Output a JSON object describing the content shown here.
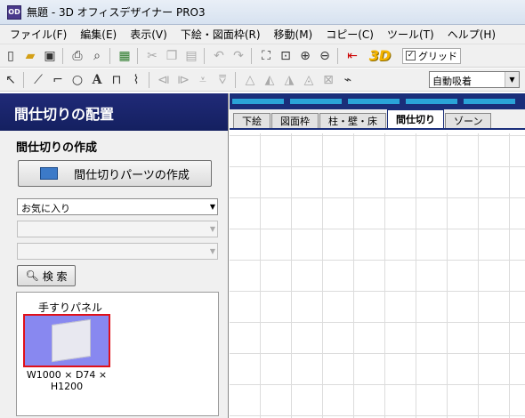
{
  "window": {
    "title": "無題 - 3D オフィスデザイナー PRO3",
    "app_icon": "OD"
  },
  "menu": [
    "ファイル(F)",
    "編集(E)",
    "表示(V)",
    "下絵・図面枠(R)",
    "移動(M)",
    "コピー(C)",
    "ツール(T)",
    "ヘルプ(H)"
  ],
  "toolbar1": {
    "view3d_label": "3D",
    "grid_label": "グリッド",
    "grid_checked": "✓"
  },
  "toolbar2": {
    "snap_value": "自動吸着"
  },
  "left_panel": {
    "header": "間仕切りの配置",
    "subtitle": "間仕切りの作成",
    "create_button": "間仕切りパーツの作成",
    "category_select": "お気に入り",
    "search_button": "検 索",
    "library_item": {
      "name": "手すりパネル",
      "dims_line1": "W1000 × D74 ×",
      "dims_line2": "H1200"
    }
  },
  "tabs": [
    "下絵",
    "図面枠",
    "柱・壁・床",
    "間仕切り",
    "ゾーン"
  ],
  "colors": {
    "accent": "#1a2e7a",
    "selection": "#e0101a",
    "stripe": "#2aa4d8"
  }
}
